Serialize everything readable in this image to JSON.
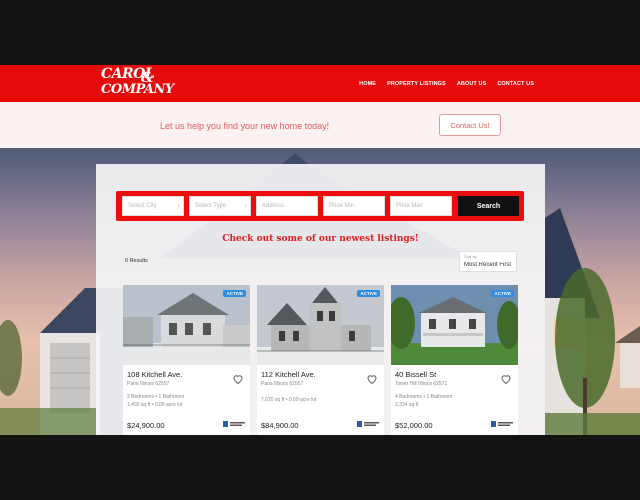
{
  "header": {
    "logo_line1": "CAROL",
    "logo_amp": "&",
    "logo_line2": "COMPANY",
    "nav": [
      "HOME",
      "PROPERTY LISTINGS",
      "ABOUT US",
      "CONTACT US"
    ]
  },
  "help": {
    "text": "Let us help you find your new home today!",
    "contact_label": "Contact Us!"
  },
  "search": {
    "city_placeholder": "Select City",
    "type_placeholder": "Select Type",
    "address_placeholder": "Address",
    "price_min_placeholder": "Price Min",
    "price_max_placeholder": "Price Max",
    "button_label": "Search"
  },
  "listings_section": {
    "headline": "Check out some of our newest listings!",
    "count": "6 Results",
    "sort_label": "Sort by",
    "sort_value": "Most Recent First"
  },
  "listings": [
    {
      "status": "ACTIVE",
      "address": "108 Kitchell Ave.",
      "city": "Pana Illinois 62557",
      "beds_baths": "2 Bedrooms • 1 Bathroom",
      "sqft": "1,492 sq ft • 0.05 acre lot",
      "price": "$24,900.00"
    },
    {
      "status": "ACTIVE",
      "address": "112 Kitchell Ave.",
      "city": "Pana Illinois 62557",
      "beds_baths": "",
      "sqft": "7,620 sq ft • 0.09 acre lot",
      "price": "$84,900.00"
    },
    {
      "status": "ACTIVE",
      "address": "40 Bissell St",
      "city": "Tower Hill Illinois 62571",
      "beds_baths": "4 Bedrooms • 1 Bathroom",
      "sqft": "2,334 sq ft",
      "price": "$52,000.00"
    }
  ],
  "colors": {
    "brand_red": "#e60a0a",
    "badge_blue": "#2f8de4",
    "headline_red": "#e11d1d"
  }
}
